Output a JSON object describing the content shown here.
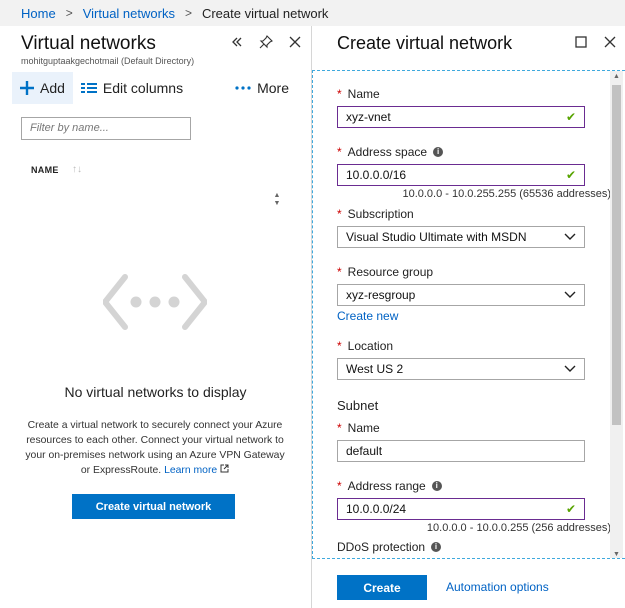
{
  "breadcrumb": {
    "home": "Home",
    "virtual_networks": "Virtual networks",
    "current": "Create virtual network",
    "separator": ">"
  },
  "left_blade": {
    "title": "Virtual networks",
    "subtitle": "mohitguptaakgechotmail (Default Directory)",
    "toolbar": {
      "add": "Add",
      "edit_columns": "Edit columns",
      "more": "More"
    },
    "filter_placeholder": "Filter by name...",
    "column_name": "NAME",
    "empty_title": "No virtual networks to display",
    "empty_desc": "Create a virtual network to securely connect your Azure resources to each other. Connect your virtual network to your on-premises network using an Azure VPN Gateway or ExpressRoute.",
    "learn_more": "Learn more",
    "create_button": "Create virtual network"
  },
  "right_blade": {
    "title": "Create virtual network",
    "fields": {
      "name_label": "Name",
      "name_value": "xyz-vnet",
      "address_space_label": "Address space",
      "address_space_value": "10.0.0.0/16",
      "address_space_hint": "10.0.0.0 - 10.0.255.255 (65536 addresses)",
      "subscription_label": "Subscription",
      "subscription_value": "Visual Studio Ultimate with MSDN",
      "resource_group_label": "Resource group",
      "resource_group_value": "xyz-resgroup",
      "create_new": "Create new",
      "location_label": "Location",
      "location_value": "West US 2",
      "subnet_section": "Subnet",
      "subnet_name_label": "Name",
      "subnet_name_value": "default",
      "address_range_label": "Address range",
      "address_range_value": "10.0.0.0/24",
      "address_range_hint": "10.0.0.0 - 10.0.0.255 (256 addresses)",
      "ddos_label": "DDoS protection"
    },
    "create_button": "Create",
    "automation_options": "Automation options"
  },
  "colors": {
    "accent": "#0072c6",
    "link": "#0062c4",
    "valid_border": "#6a2c91",
    "check": "#57a300",
    "required": "#cc0000"
  }
}
